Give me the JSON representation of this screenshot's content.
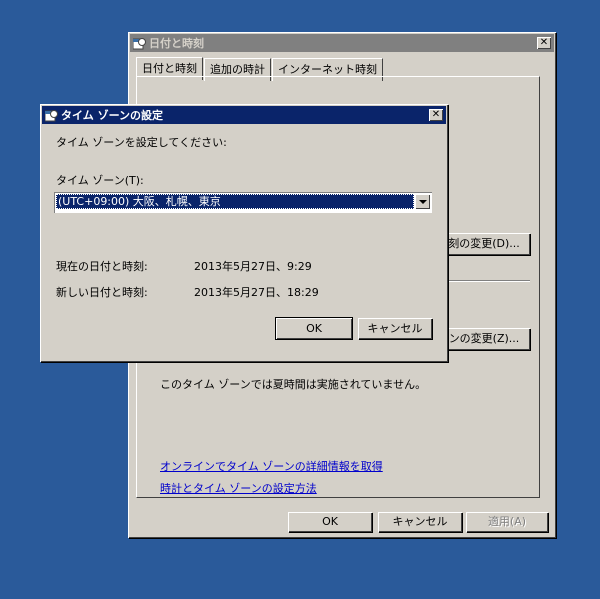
{
  "main_window": {
    "title": "日付と時刻",
    "close": "✕",
    "tabs": [
      "日付と時刻",
      "追加の時計",
      "インターネット時刻"
    ],
    "change_datetime_button": "刻の変更(D)...",
    "change_timezone_button": "ンの変更(Z)...",
    "dst_text": "このタイム ゾーンでは夏時間は実施されていません。",
    "link_online": "オンラインでタイム ゾーンの詳細情報を取得",
    "link_settings": "時計とタイム ゾーンの設定方法",
    "ok": "OK",
    "cancel": "キャンセル",
    "apply": "適用(A)"
  },
  "dialog": {
    "title": "タイム ゾーンの設定",
    "close": "✕",
    "instruction": "タイム ゾーンを設定してください:",
    "timezone_label": "タイム ゾーン(T):",
    "timezone_value": "(UTC+09:00) 大阪、札幌、東京",
    "current_label": "現在の日付と時刻:",
    "current_value": "2013年5月27日、9:29",
    "new_label": "新しい日付と時刻:",
    "new_value": "2013年5月27日、18:29",
    "ok": "OK",
    "cancel": "キャンセル"
  }
}
